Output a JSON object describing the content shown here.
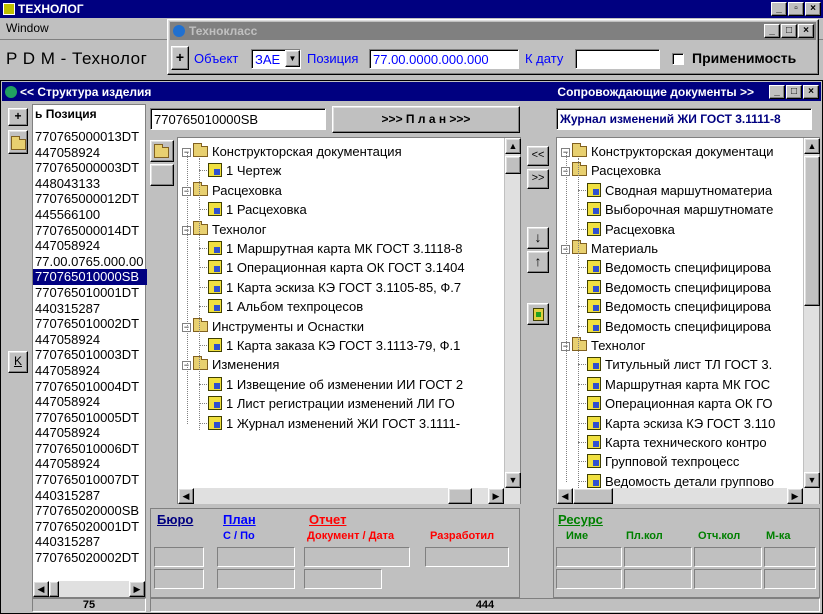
{
  "app": {
    "title": "ТЕХНОЛОГ",
    "menu_window": "Window",
    "pdm_label": "P D M - Технолог"
  },
  "dialog": {
    "title": "Технокласс",
    "add": "+",
    "object_label": "Объект",
    "object_value": "ЗАЕ",
    "position_label": "Позиция",
    "position_value": "77.00.0000.000.000",
    "date_label": "К дату",
    "date_value": "",
    "applicability_label": "Применимость"
  },
  "struct": {
    "title": "<< Структура изделия",
    "docs_title": "Сопровождающие документы   >>"
  },
  "left": {
    "header": "ь Позиция",
    "status": "75",
    "items": [
      "770765000013DT",
      "447058924",
      "770765000003DT",
      "448043133",
      "770765000012DT",
      "445566100",
      "770765000014DT",
      "447058924",
      "77.00.0765.000.00",
      "770765010000SB",
      "770765010001DT",
      "440315287",
      "770765010002DT",
      "447058924",
      "770765010003DT",
      "447058924",
      "770765010004DT",
      "447058924",
      "770765010005DT",
      "447058924",
      "770765010006DT",
      "447058924",
      "770765010007DT",
      "440315287",
      "770765020000SB",
      "770765020001DT",
      "440315287",
      "770765020002DT"
    ],
    "selected_index": 9,
    "k_btn": "K",
    "plus_btn": "+"
  },
  "middle": {
    "code": "770765010000SB",
    "plan_btn": ">>> П л а н >>>",
    "tree": [
      {
        "lvl": 0,
        "t": "f",
        "text": "Конструкторская документация"
      },
      {
        "lvl": 1,
        "t": "d",
        "text": "1 Чертеж"
      },
      {
        "lvl": 0,
        "t": "f",
        "text": "Расцеховка"
      },
      {
        "lvl": 1,
        "t": "d",
        "text": "1 Расцеховка"
      },
      {
        "lvl": 0,
        "t": "f",
        "text": "Технолог"
      },
      {
        "lvl": 1,
        "t": "d",
        "text": "1 Маршрутная карта МК ГОСТ 3.1118-8"
      },
      {
        "lvl": 1,
        "t": "d",
        "text": "1 Операционная карта ОК ГОСТ 3.1404"
      },
      {
        "lvl": 1,
        "t": "d",
        "text": "1 Карта эскиза КЭ ГОСТ 3.1105-85, Ф.7"
      },
      {
        "lvl": 1,
        "t": "d",
        "text": "1 Альбом техпроцесов"
      },
      {
        "lvl": 0,
        "t": "f",
        "text": "Инструменты и Оснастки"
      },
      {
        "lvl": 1,
        "t": "d",
        "text": "1 Карта заказа КЭ ГОСТ 3.1113-79, Ф.1"
      },
      {
        "lvl": 0,
        "t": "f",
        "text": "Изменения"
      },
      {
        "lvl": 1,
        "t": "d",
        "text": "1 Извещение об изменении ИИ ГОСТ 2"
      },
      {
        "lvl": 1,
        "t": "d",
        "text": "1 Лист регистрации изменений ЛИ ГО"
      },
      {
        "lvl": 1,
        "t": "d",
        "text": "1 Журнал изменений ЖИ ГОСТ 3.1111-"
      }
    ]
  },
  "mid_buttons": {
    "left": "<<",
    "right": ">>",
    "down": "↓",
    "up": "↑"
  },
  "right": {
    "journal": "Журнал изменений ЖИ ГОСТ 3.1111-8",
    "tree": [
      {
        "lvl": 0,
        "t": "f",
        "text": "Конструкторская документаци"
      },
      {
        "lvl": 0,
        "t": "f",
        "text": "Расцеховка"
      },
      {
        "lvl": 1,
        "t": "d",
        "text": "Сводная маршутноматериа"
      },
      {
        "lvl": 1,
        "t": "d",
        "text": "Выборочная маршутномате"
      },
      {
        "lvl": 1,
        "t": "d",
        "text": "Расцеховка"
      },
      {
        "lvl": 0,
        "t": "f",
        "text": "Материаль"
      },
      {
        "lvl": 1,
        "t": "d",
        "text": "Ведомость специфицирова"
      },
      {
        "lvl": 1,
        "t": "d",
        "text": "Ведомость специфицирова"
      },
      {
        "lvl": 1,
        "t": "d",
        "text": "Ведомость специфицирова"
      },
      {
        "lvl": 1,
        "t": "d",
        "text": "Ведомость специфицирова"
      },
      {
        "lvl": 0,
        "t": "f",
        "text": "Технолог"
      },
      {
        "lvl": 1,
        "t": "d",
        "text": "Титульный лист ТЛ ГОСТ 3."
      },
      {
        "lvl": 1,
        "t": "d",
        "text": "Маршрутная карта МК ГОС"
      },
      {
        "lvl": 1,
        "t": "d",
        "text": "Операционная карта ОК ГО"
      },
      {
        "lvl": 1,
        "t": "d",
        "text": "Карта эскиза КЭ ГОСТ 3.110"
      },
      {
        "lvl": 1,
        "t": "d",
        "text": "Карта технического контро"
      },
      {
        "lvl": 1,
        "t": "d",
        "text": "Групповой техпроцесс"
      },
      {
        "lvl": 1,
        "t": "d",
        "text": "Ведомость детали группово"
      }
    ]
  },
  "bottom": {
    "buro": "Бюро",
    "plan": "План",
    "plan_sub": "С / По",
    "report": "Отчет",
    "report_sub": "Документ / Дата",
    "developed": "Разработил",
    "resource": "Ресурс",
    "res_cols": [
      "Име",
      "Пл.кол",
      "Отч.кол",
      "М-ка"
    ],
    "status_mid": "444"
  },
  "colors": {
    "title_active": "#000080",
    "title_inactive": "#808080",
    "face": "#c0c0c0",
    "link_blue": "#0000ff",
    "red": "#ff0000",
    "green": "#008000"
  }
}
